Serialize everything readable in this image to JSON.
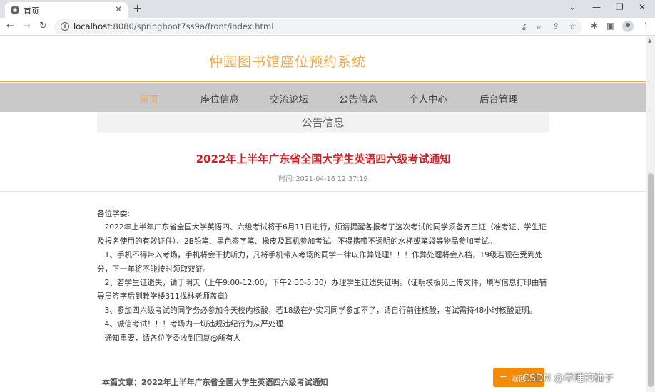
{
  "browser": {
    "tab_title": "首页",
    "tab_close": "✕",
    "new_tab": "+",
    "url_host": "localhost",
    "url_rest": ":8080/springboot7ss9a/front/index.html",
    "window_controls": [
      "⌄",
      "—",
      "❐",
      "✕"
    ]
  },
  "site": {
    "title": "仲园图书馆座位预约系统",
    "accent_color": "#f5a742"
  },
  "nav": {
    "items": [
      {
        "label": "首页",
        "active": true
      },
      {
        "label": "座位信息",
        "active": false
      },
      {
        "label": "交流论坛",
        "active": false
      },
      {
        "label": "公告信息",
        "active": false
      },
      {
        "label": "个人中心",
        "active": false
      },
      {
        "label": "后台管理",
        "active": false
      }
    ]
  },
  "section": {
    "title": "公告信息"
  },
  "article": {
    "title": "2022年上半年广东省全国大学生英语四六级考试通知",
    "time_label": "时间:",
    "time_value": "2021-04-16 12:37:19",
    "title_color": "#c8242b",
    "paragraphs": [
      "各位学委:",
      "　2022年上半年广东省全国大学英语四、六级考试将于6月11日进行，烦请提醒各报考了这次考试的同学须备齐三证（准考证、学生证及报名使用的有效证件）、2B铅笔、黑色签字笔、橡皮及耳机参加考试。不得携带不透明的水杯或笔袋等物品参加考试。",
      "　1、手机不得带入考场，手机将会干扰听力，凡将手机带入考场的同学一律以作弊处理！！！作弊处理将会入档，19级若现在受到处分，下一年将不能按时领取双证。",
      "　2、若学生证遗失，请于明天（上午9:00-12:00，下午2:30-5:30）办理学生证遗失证明。（证明模板见上传文件，填写信息打印由辅导员签字后到教学楼311找林老师盖章）",
      "　3、参加四六级考试的同学务必参加今天校内核酸，若18级在外实习同学参加不了，请自行前往核酸，考试需持48小时核酸证明。",
      "　4、诚信考试！！！考场内一切违规违纪行为从严处理",
      "　通知重要，请各位学委收到回复@所有人"
    ]
  },
  "footer": {
    "ref_label": "本篇文章：",
    "ref_title": "2022年上半年广东省全国大学生英语四六级考试通知",
    "back_label": "返回",
    "back_color": "#f58b0c"
  },
  "watermark": "CSDN @早睡的柚子"
}
